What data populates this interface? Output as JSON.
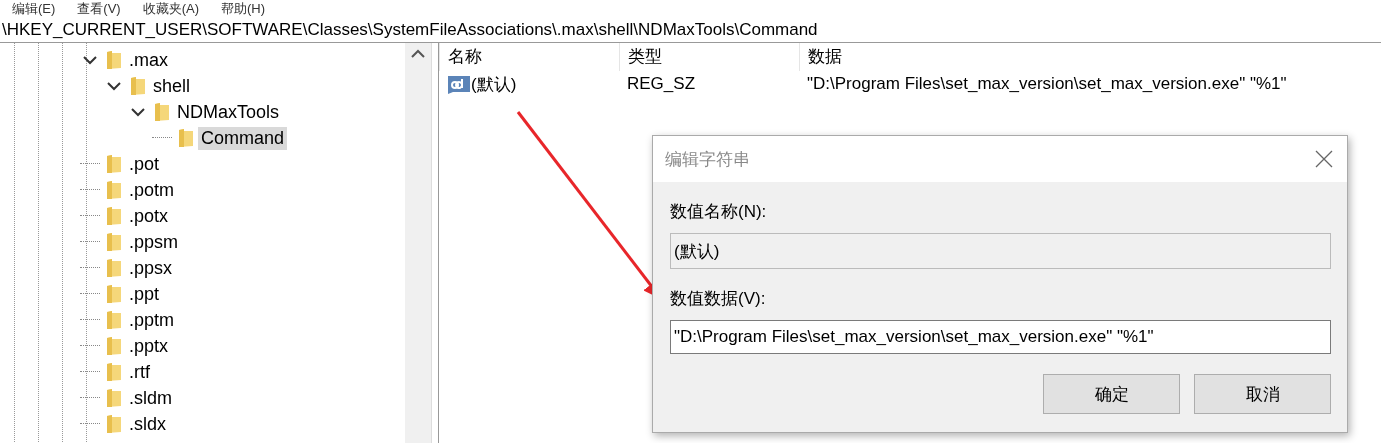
{
  "menu": [
    "编辑(E)",
    "查看(V)",
    "收藏夹(A)",
    "帮助(H)"
  ],
  "address": "\\HKEY_CURRENT_USER\\SOFTWARE\\Classes\\SystemFileAssociations\\.max\\shell\\NDMaxTools\\Command",
  "tree": [
    {
      "label": ".max",
      "expanded": true,
      "selected": false,
      "children": [
        {
          "label": "shell",
          "expanded": true,
          "selected": false,
          "children": [
            {
              "label": "NDMaxTools",
              "expanded": true,
              "selected": false,
              "children": [
                {
                  "label": "Command",
                  "selected": true
                }
              ]
            }
          ]
        }
      ]
    },
    {
      "label": ".pot",
      "selected": false
    },
    {
      "label": ".potm",
      "selected": false
    },
    {
      "label": ".potx",
      "selected": false
    },
    {
      "label": ".ppsm",
      "selected": false
    },
    {
      "label": ".ppsx",
      "selected": false
    },
    {
      "label": ".ppt",
      "selected": false
    },
    {
      "label": ".pptm",
      "selected": false
    },
    {
      "label": ".pptx",
      "selected": false
    },
    {
      "label": ".rtf",
      "selected": false
    },
    {
      "label": ".sldm",
      "selected": false
    },
    {
      "label": ".sldx",
      "selected": false
    }
  ],
  "columns": [
    "名称",
    "类型",
    "数据"
  ],
  "values": [
    {
      "name": "(默认)",
      "type": "REG_SZ",
      "data": "\"D:\\Program Files\\set_max_version\\set_max_version.exe\" \"%1\""
    }
  ],
  "dialog": {
    "title": "编辑字符串",
    "name_label": "数值名称(N):",
    "name_value": "(默认)",
    "data_label": "数值数据(V):",
    "data_value": "\"D:\\Program Files\\set_max_version\\set_max_version.exe\" \"%1\"",
    "buttons": [
      "确定",
      "取消"
    ]
  }
}
